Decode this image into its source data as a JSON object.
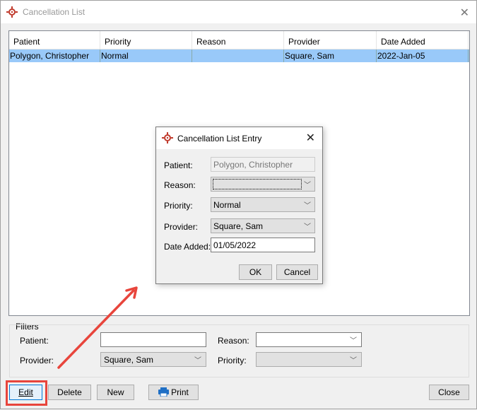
{
  "window": {
    "title": "Cancellation List",
    "close_icon": "close-x-icon",
    "app_icon": "target-crosshair-icon"
  },
  "list": {
    "columns": [
      "Patient",
      "Priority",
      "Reason",
      "Provider",
      "Date Added"
    ],
    "rows": [
      {
        "patient": "Polygon, Christopher",
        "priority": "Normal",
        "reason": "",
        "provider": "Square, Sam",
        "date_added": "2022-Jan-05",
        "selected": true
      }
    ]
  },
  "dialog": {
    "title": "Cancellation List Entry",
    "patient_label": "Patient:",
    "patient_value": "Polygon, Christopher",
    "reason_label": "Reason:",
    "reason_value": "",
    "priority_label": "Priority:",
    "priority_value": "Normal",
    "provider_label": "Provider:",
    "provider_value": "Square, Sam",
    "date_label": "Date Added:",
    "date_value": "01/05/2022",
    "ok_label": "OK",
    "cancel_label": "Cancel"
  },
  "filters": {
    "legend": "Filters",
    "patient_label": "Patient:",
    "patient_value": "",
    "reason_label": "Reason:",
    "reason_value": "",
    "provider_label": "Provider:",
    "provider_value": "Square, Sam",
    "priority_label": "Priority:",
    "priority_value": ""
  },
  "buttons": {
    "edit": "Edit",
    "delete": "Delete",
    "new": "New",
    "print": "Print",
    "close": "Close"
  },
  "colors": {
    "selection": "#99c9f9",
    "annotation": "#e8453c",
    "icon_red": "#c0392b",
    "print_icon": "#1f6fc5"
  }
}
